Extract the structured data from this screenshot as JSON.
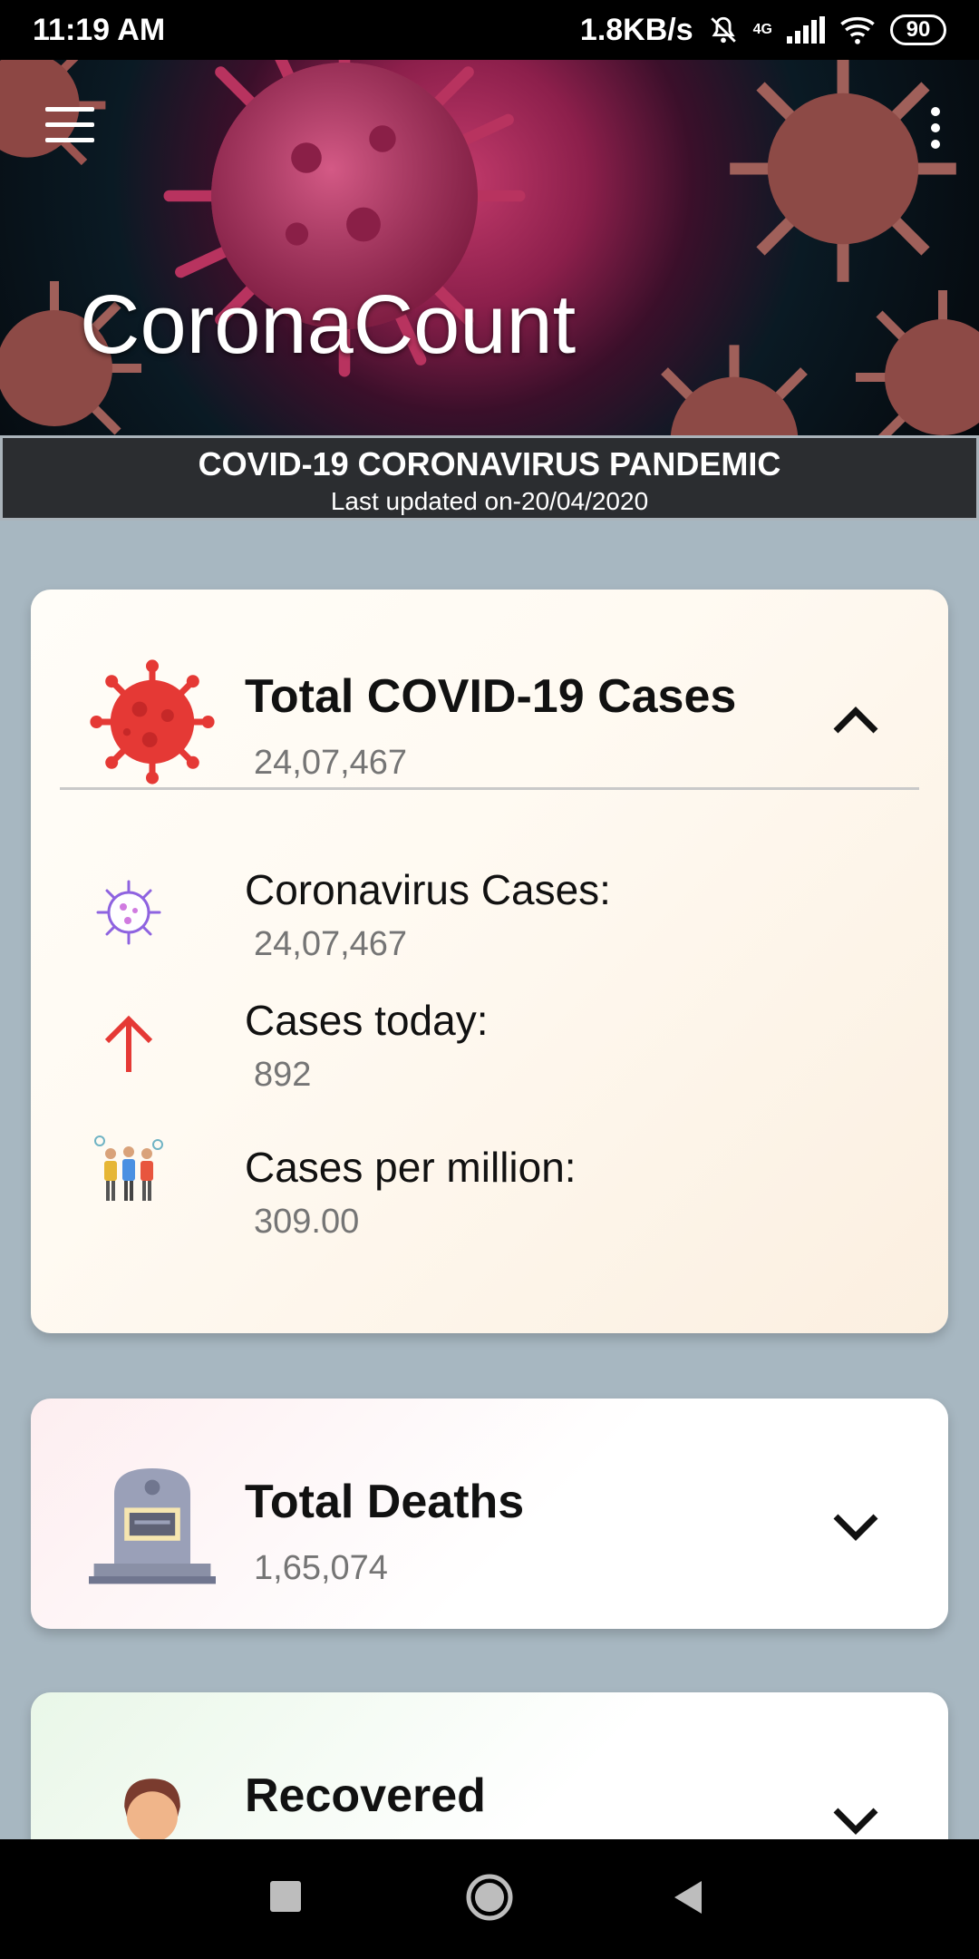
{
  "status_bar": {
    "time": "11:19 AM",
    "speed": "1.8KB/s",
    "network": "4G",
    "battery": "90"
  },
  "header": {
    "app_title": "CoronaCount"
  },
  "banner": {
    "title": "COVID-19 CORONAVIRUS PANDEMIC",
    "subtitle": "Last updated on-20/04/2020"
  },
  "cards": {
    "total_cases": {
      "title": "Total COVID-19 Cases",
      "value": "24,07,467",
      "expanded": true,
      "rows": [
        {
          "label": "Coronavirus Cases:",
          "value": "24,07,467"
        },
        {
          "label": "Cases today:",
          "value": "892"
        },
        {
          "label": "Cases per million:",
          "value": "309.00"
        }
      ]
    },
    "total_deaths": {
      "title": "Total Deaths",
      "value": "1,65,074",
      "expanded": false
    },
    "recovered": {
      "title": "Recovered",
      "expanded": false
    }
  },
  "icons": {
    "menu": "hamburger-menu-icon",
    "more": "more-vert-icon",
    "cases": "virus-icon",
    "deaths": "tombstone-icon",
    "recovered": "recovered-person-icon"
  },
  "colors": {
    "accent_red": "#e53935",
    "banner_bg": "#2b2d30",
    "page_bg": "#a7b7c1"
  }
}
